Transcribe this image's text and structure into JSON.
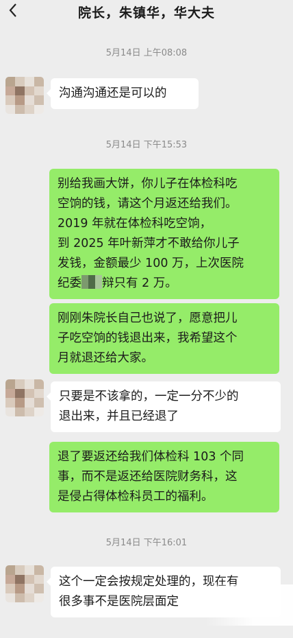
{
  "header": {
    "back_icon": "chevron-left-icon",
    "title": "院长，朱镇华，华大夫"
  },
  "timestamps": [
    "5月14日 上午08:08",
    "5月14日 下午15:53",
    "5月14日 下午16:01"
  ],
  "messages": [
    {
      "side": "in",
      "text": "沟通沟通还是可以的"
    },
    {
      "side": "out",
      "text": "别给我画大饼，你儿子在体检科吃\n空饷的钱，请这个月返还给我们。\n2019 年就在体检科吃空饷，\n到 2025 年叶新萍才不敢给你儿子\n发钱，金额最少 100 万，上次医院\n纪委",
      "text_tail": "辩只有 2 万。"
    },
    {
      "side": "out",
      "text": "刚刚朱院长自己也说了，愿意把儿\n子吃空饷的钱退出来，我希望这个\n月就退还给大家。"
    },
    {
      "side": "in",
      "text": "只要是不该拿的，一定一分不少的\n退出来，并且已经退了"
    },
    {
      "side": "out",
      "text": "退了要返还给我们体检科 103 个同\n事，而不是返还给医院财务科，这\n是侵占得体检科员工的福利。"
    },
    {
      "side": "in",
      "text": "这个一定会按规定处理的，现在有\n很多事不是医院层面定"
    }
  ],
  "colors": {
    "background": "#ededed",
    "incoming": "#ffffff",
    "outgoing": "#95ec69"
  }
}
